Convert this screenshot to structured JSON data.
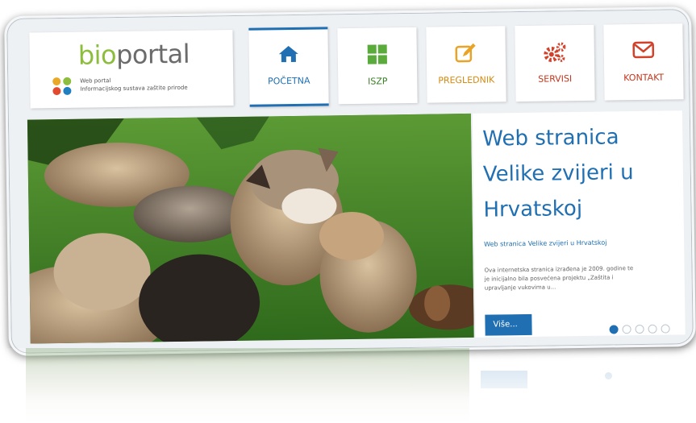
{
  "logo": {
    "bio": "bio",
    "portal": "portal",
    "subtitle_line1": "Web portal",
    "subtitle_line2": "Informacijskog sustava zaštite prirode"
  },
  "nav": [
    {
      "label": "POČETNA",
      "icon": "home-icon",
      "color": "#1f6fb2",
      "active": true
    },
    {
      "label": "ISZP",
      "icon": "grid-icon",
      "color": "#5aaa3c",
      "active": false
    },
    {
      "label": "PREGLEDNIK",
      "icon": "edit-icon",
      "color": "#e9a326",
      "active": false
    },
    {
      "label": "SERVISI",
      "icon": "gears-icon",
      "color": "#d2422b",
      "active": false
    },
    {
      "label": "KONTAKT",
      "icon": "envelope-icon",
      "color": "#d2422b",
      "active": false
    }
  ],
  "slide": {
    "title_line1": "Web stranica",
    "title_line2": "Velike zvijeri u",
    "title_line3": "Hrvatskoj",
    "subtitle": "Web stranica Velike zvijeri u Hrvatskoj",
    "text_line1": "Ova internetska stranica izrađena je 2009. godine te",
    "text_line2": "je inicijalno bila posvećena projektu „Zaštita i",
    "text_line3": "upravljanje vukovima u...",
    "more_label": "Više...",
    "image_description": "wolf pups and adult wolf on grass",
    "slide_count": 5,
    "active_slide": 1
  },
  "colors": {
    "accent_blue": "#1f6fb2",
    "green": "#8cbd3c",
    "orange": "#e9a326",
    "red": "#d2422b"
  }
}
